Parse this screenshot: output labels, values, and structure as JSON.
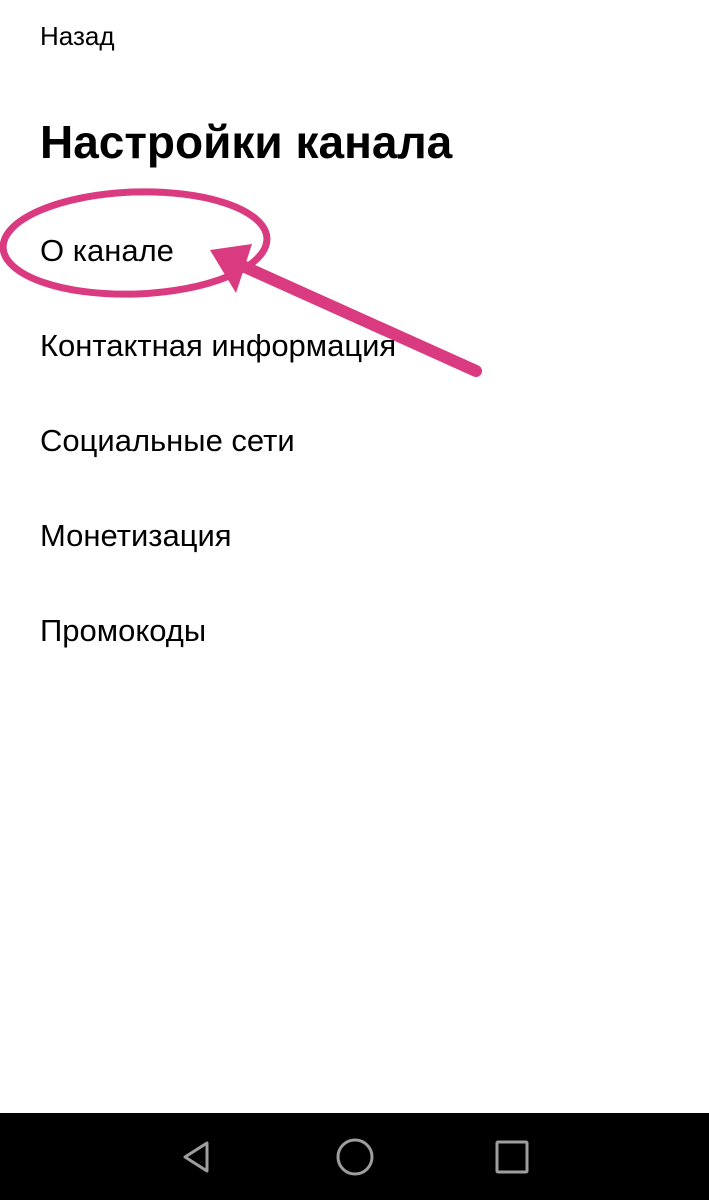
{
  "header": {
    "back_label": "Назад",
    "title": "Настройки канала"
  },
  "menu": {
    "items": [
      {
        "label": "О канале"
      },
      {
        "label": "Контактная информация"
      },
      {
        "label": "Социальные сети"
      },
      {
        "label": "Монетизация"
      },
      {
        "label": "Промокоды"
      }
    ]
  },
  "annotation": {
    "color": "#DA3A80",
    "highlighted_item": "О канале"
  },
  "navbar": {
    "buttons": [
      {
        "icon": "back-triangle-icon"
      },
      {
        "icon": "home-circle-icon"
      },
      {
        "icon": "recents-square-icon"
      }
    ],
    "background": "#000000",
    "icon_color": "#9E9E9E"
  }
}
